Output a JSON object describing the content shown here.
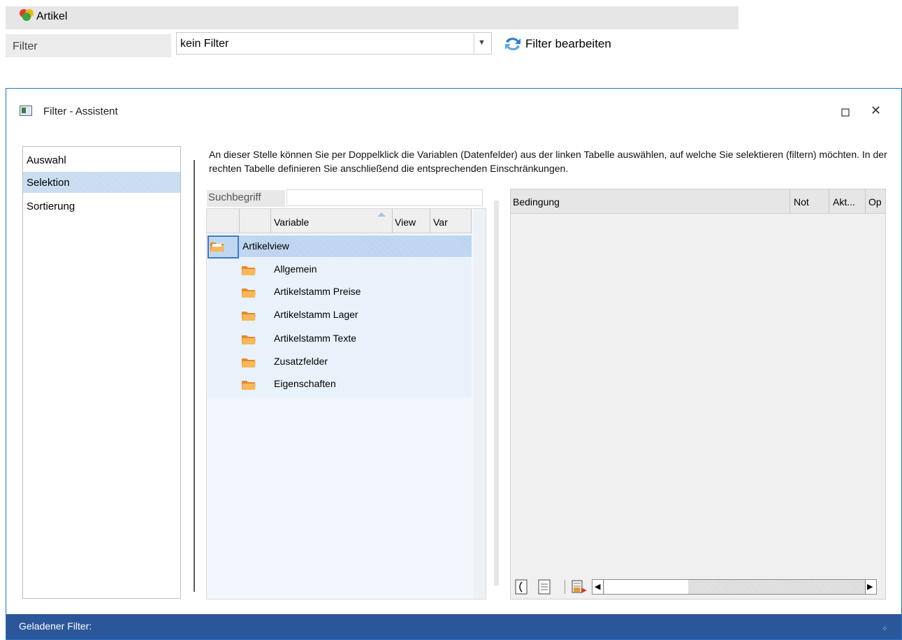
{
  "artikel": {
    "title": "Artikel"
  },
  "filter": {
    "label": "Filter",
    "value": "kein Filter",
    "edit_label": "Filter bearbeiten"
  },
  "dialog": {
    "title": "Filter - Assistent",
    "nav": [
      {
        "label": "Auswahl",
        "selected": false
      },
      {
        "label": "Selektion",
        "selected": true
      },
      {
        "label": "Sortierung",
        "selected": false
      }
    ],
    "description": "An dieser Stelle können Sie per Doppelklick die Variablen (Datenfelder) aus der linken Tabelle auswählen, auf welche Sie selektieren (filtern) möchten. In der rechten Tabelle definieren Sie anschließend die entsprechenden Einschränkungen.",
    "search": {
      "label": "Suchbegriff",
      "value": ""
    },
    "variables_grid": {
      "headers": [
        "Variable",
        "View",
        "Var"
      ],
      "root": "Artikelview",
      "children": [
        "Allgemein",
        "Artikelstamm Preise",
        "Artikelstamm Lager",
        "Artikelstamm Texte",
        "Zusatzfelder",
        "Eigenschaften"
      ]
    },
    "conditions_grid": {
      "headers": [
        "Bedingung",
        "Not",
        "Akt...",
        "Op"
      ]
    },
    "status": "Geladener Filter:"
  },
  "colors": {
    "statusbar": "#2b579a",
    "selection": "#b7d1ee",
    "window_border": "#1979ca"
  }
}
